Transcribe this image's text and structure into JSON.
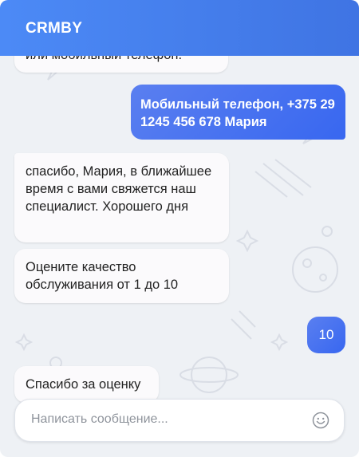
{
  "header": {
    "title": "CRMBY"
  },
  "messages": [
    {
      "from": "bot",
      "text": "или мобильный телефон."
    },
    {
      "from": "user",
      "text": "Мобильный телефон, +375 29 1245 456 678 Мария"
    },
    {
      "from": "bot",
      "text": "спасибо, Мария, в ближайшее время с вами свяжется наш специалист. Хорошего дня"
    },
    {
      "from": "bot",
      "text": "Оцените качество обслуживания от 1 до 10"
    },
    {
      "from": "user",
      "text": "10"
    },
    {
      "from": "bot",
      "text": "Спасибо за оценку"
    }
  ],
  "composer": {
    "placeholder": "Написать сообщение...",
    "emoji_icon": "smiley-icon"
  },
  "colors": {
    "accent": "#3f74e3",
    "user_bubble": "#3a69f0",
    "background": "#eef1f5"
  }
}
